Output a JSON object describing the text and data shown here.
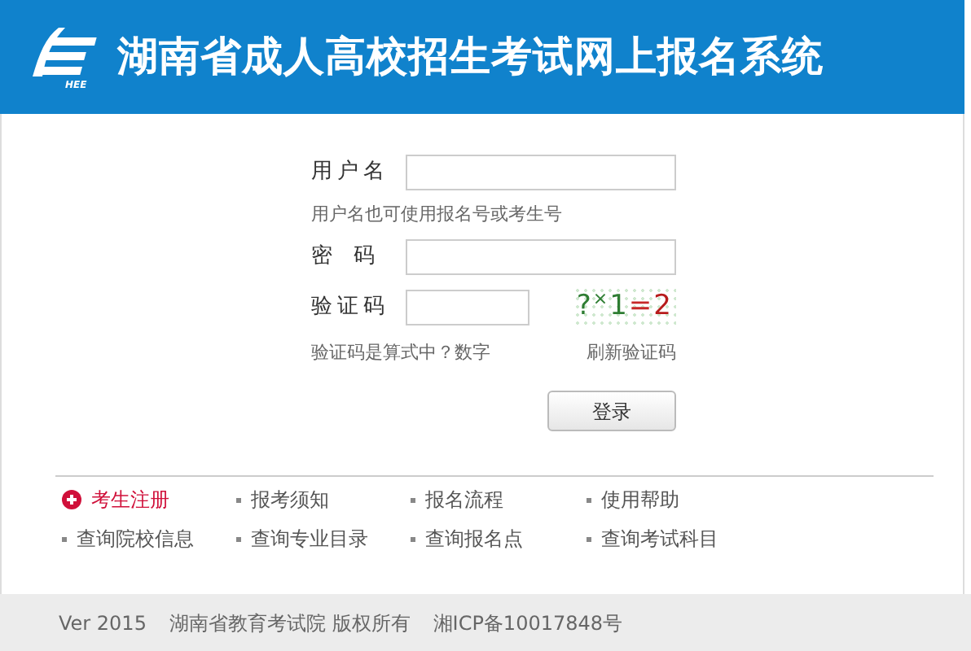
{
  "header": {
    "logo_text": "HEE",
    "title": "湖南省成人高校招生考试网上报名系统"
  },
  "form": {
    "username": {
      "label": "用户名",
      "hint": "用户名也可使用报名号或考生号"
    },
    "password": {
      "label": "密　码"
    },
    "captcha": {
      "label": "验证码",
      "chars": [
        {
          "char": "?",
          "color": "#2e7d32"
        },
        {
          "char": "×",
          "color": "#2e7d32"
        },
        {
          "char": "1",
          "color": "#2e7d32"
        },
        {
          "char": "=",
          "color": "#c62828"
        },
        {
          "char": "2",
          "color": "#b71c1c"
        }
      ],
      "hint": "验证码是算式中？数字",
      "refresh": "刷新验证码"
    },
    "submit": "登录"
  },
  "links": [
    {
      "kind": "register",
      "label": "考生注册"
    },
    {
      "kind": "bullet",
      "label": "报考须知"
    },
    {
      "kind": "bullet",
      "label": "报名流程"
    },
    {
      "kind": "bullet",
      "label": "使用帮助"
    },
    {
      "kind": "bullet",
      "label": "查询院校信息"
    },
    {
      "kind": "bullet",
      "label": "查询专业目录"
    },
    {
      "kind": "bullet",
      "label": "查询报名点"
    },
    {
      "kind": "bullet",
      "label": "查询考试科目"
    }
  ],
  "footer": {
    "version": "Ver 2015",
    "owner": "湖南省教育考试院 版权所有",
    "icp": "湘ICP备10017848号"
  }
}
